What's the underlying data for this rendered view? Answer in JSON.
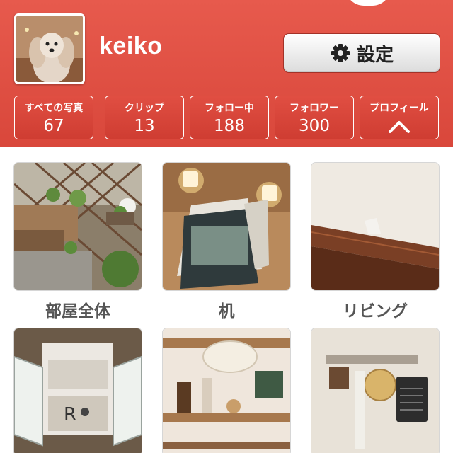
{
  "profile": {
    "username": "keiko",
    "settings_label": "設定"
  },
  "stats": [
    {
      "label": "すべての写真",
      "value": "67"
    },
    {
      "label": "クリップ",
      "value": "13"
    },
    {
      "label": "フォロー中",
      "value": "188"
    },
    {
      "label": "フォロワー",
      "value": "300"
    },
    {
      "label": "プロフィール",
      "icon": "chevron-up-icon"
    }
  ],
  "albums": [
    {
      "caption": "部屋全体"
    },
    {
      "caption": "机"
    },
    {
      "caption": "リビング"
    },
    {
      "caption": ""
    },
    {
      "caption": ""
    },
    {
      "caption": ""
    }
  ],
  "colors": {
    "header": "#e0514a",
    "button_face": "#f2f2f2",
    "caption": "#555555"
  }
}
